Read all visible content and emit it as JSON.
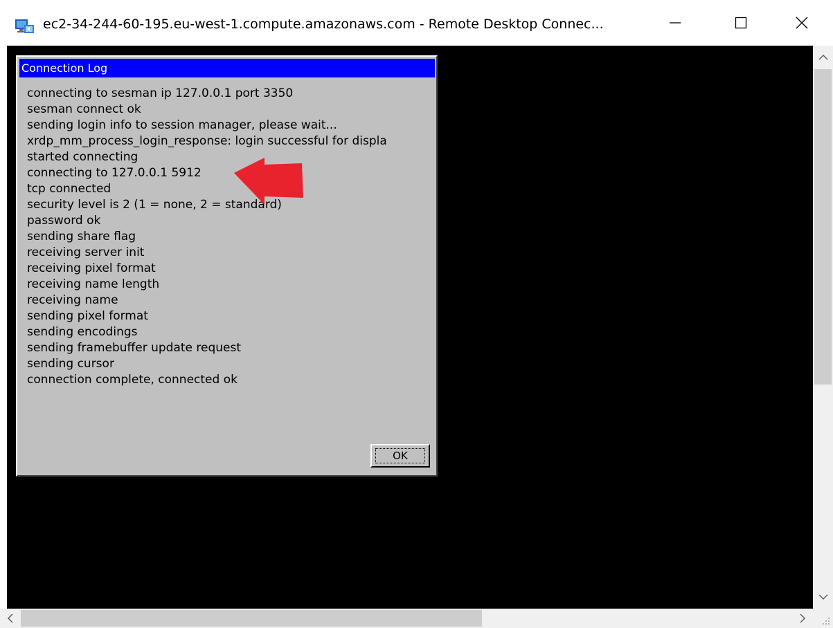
{
  "window": {
    "title": "ec2-34-244-60-195.eu-west-1.compute.amazonaws.com - Remote Desktop Connec...",
    "app_icon": "remote-desktop-icon",
    "controls": {
      "minimize": "minimize-icon",
      "maximize": "maximize-icon",
      "close": "close-icon"
    }
  },
  "dialog": {
    "title": "Connection Log",
    "title_bg": "#0000ff",
    "log_lines": [
      "connecting to sesman ip 127.0.0.1 port 3350",
      "sesman connect ok",
      "sending login info to session manager, please wait...",
      "xrdp_mm_process_login_response: login successful for displa",
      "started connecting",
      "connecting to 127.0.0.1 5912",
      "tcp connected",
      "security level is 2 (1 = none, 2 = standard)",
      "password ok",
      "sending share flag",
      "receiving server init",
      "receiving pixel format",
      "receiving name length",
      "receiving name",
      "sending pixel format",
      "sending encodings",
      "sending framebuffer update request",
      "sending cursor",
      "connection complete, connected ok"
    ],
    "ok_label": "OK"
  },
  "annotation": {
    "icon": "red-arrow-left-icon",
    "color": "#e8232e"
  },
  "scrollbars": {
    "up": "chevron-up-icon",
    "down": "chevron-down-icon",
    "left": "chevron-left-icon",
    "right": "chevron-right-icon"
  }
}
